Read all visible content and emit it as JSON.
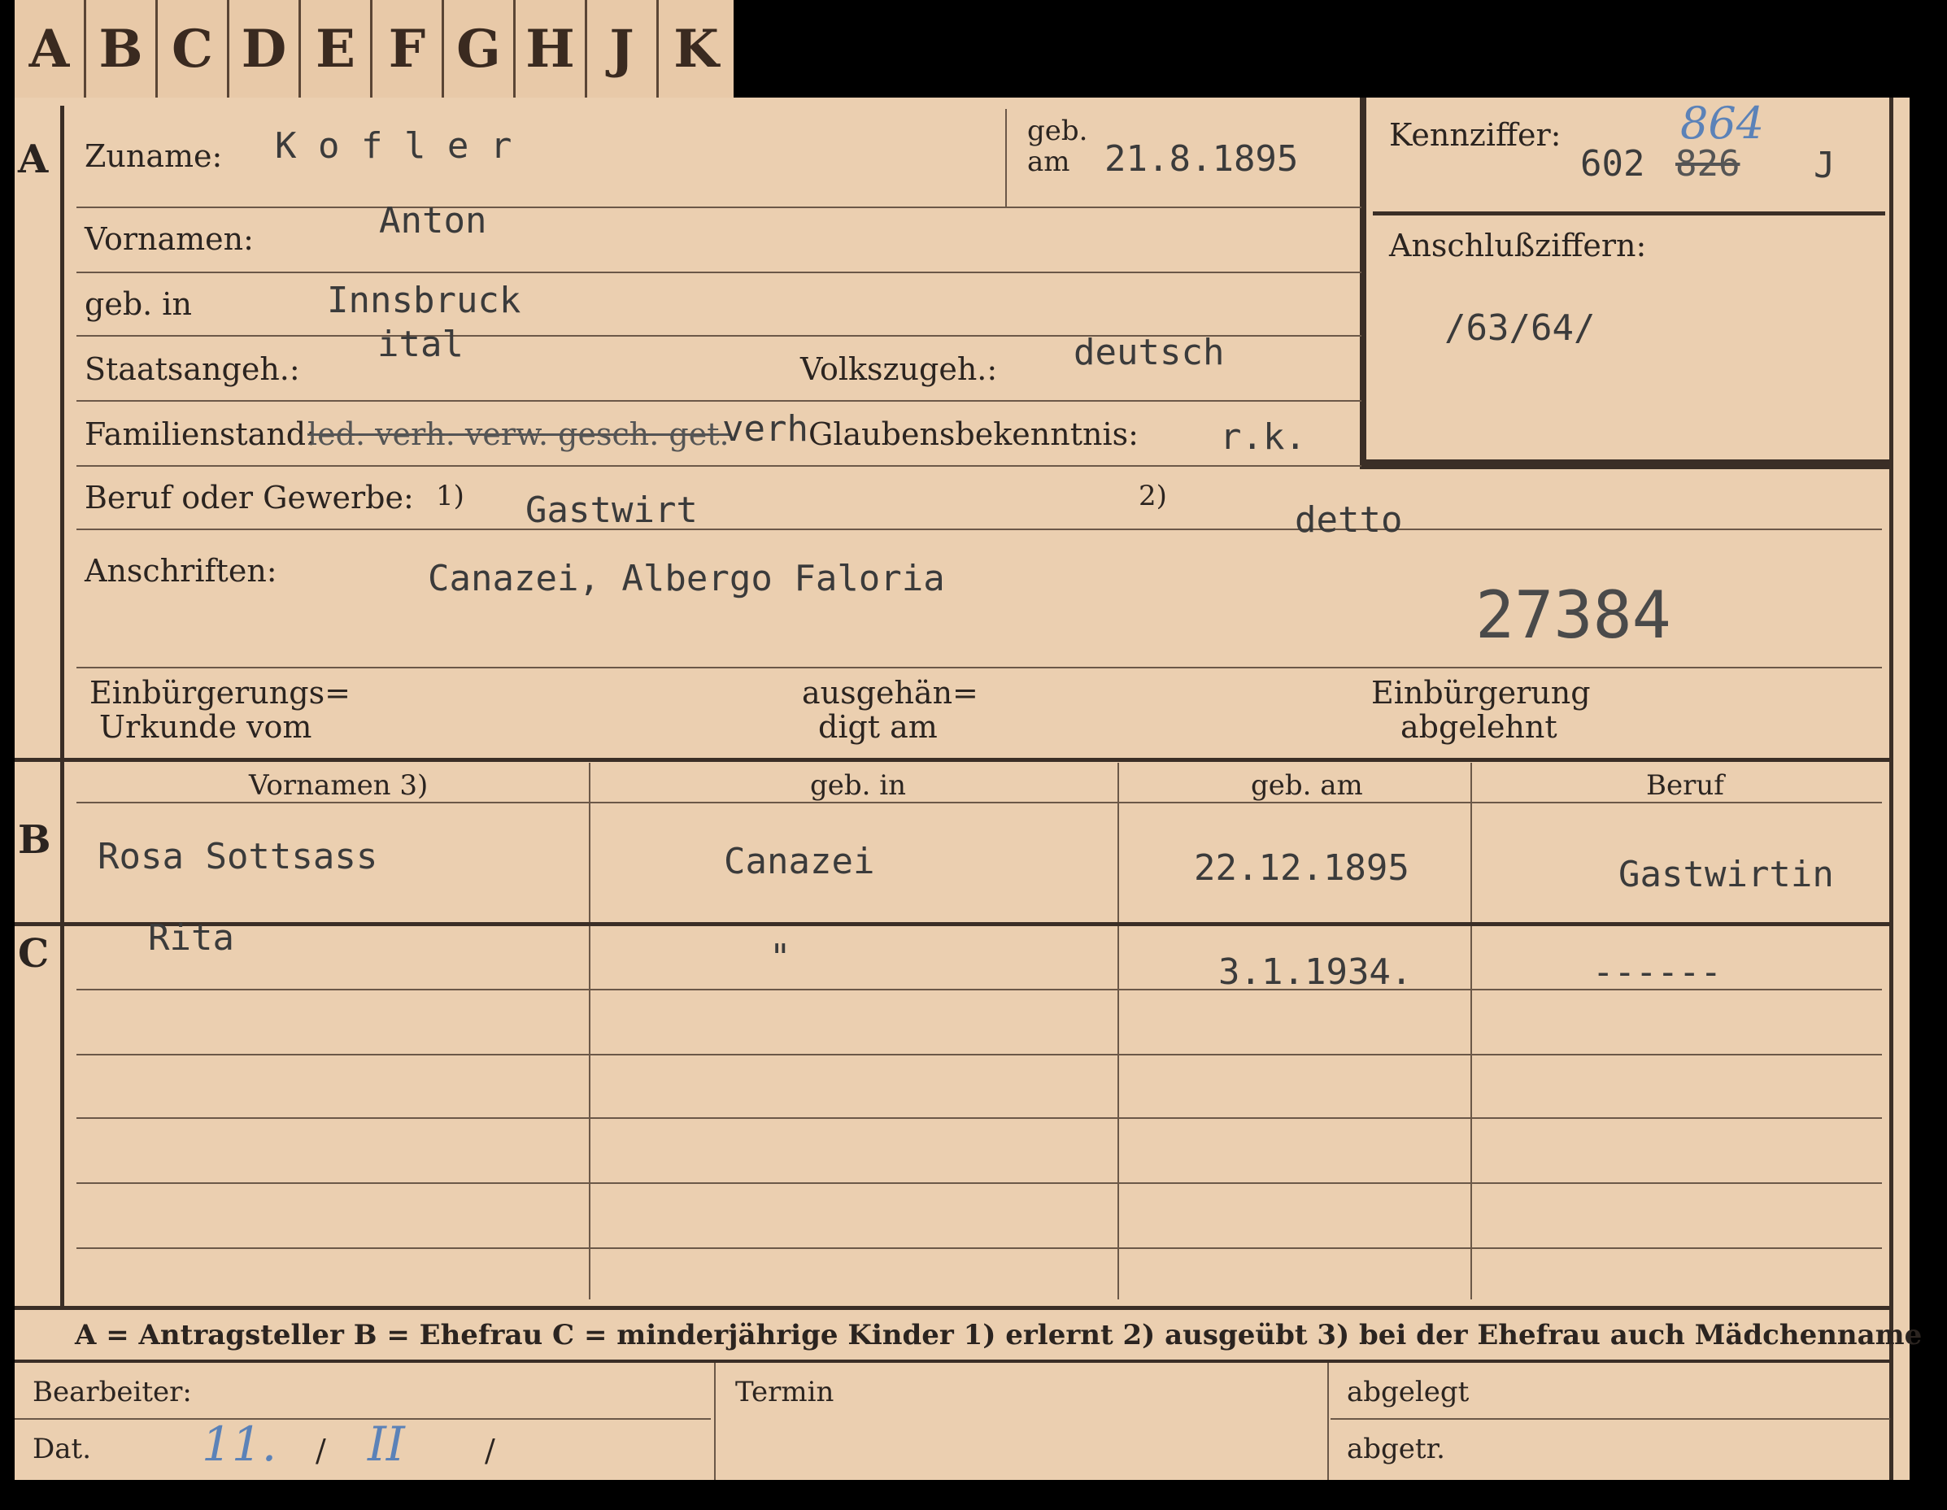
{
  "tabs": [
    "A",
    "B",
    "C",
    "D",
    "E",
    "F",
    "G",
    "H",
    "J",
    "K"
  ],
  "sections": {
    "a": "A",
    "b": "B",
    "c": "C"
  },
  "labels": {
    "zuname": "Zuname:",
    "geb_am": "geb. am",
    "kennziffer": "Kennziffer:",
    "vornamen": "Vornamen:",
    "anschluss": "Anschlußziffern:",
    "geb_in": "geb. in",
    "staatsangeh": "Staatsangeh.:",
    "volkszugeh": "Volkszugeh.:",
    "familienstand": "Familienstand:",
    "familienstand_options": "led. verh. verw. gesch. get.",
    "glaubens": "Glaubensbekenntnis:",
    "beruf": "Beruf oder Gewerbe:",
    "note1": "1)",
    "note2": "2)",
    "anschriften": "Anschriften:",
    "einb_urkunde_1": "Einbürgerungs=",
    "einb_urkunde_2": "Urkunde vom",
    "ausgeh_1": "ausgehän=",
    "ausgeh_2": "digt am",
    "einb_abgelehnt_1": "Einbürgerung",
    "einb_abgelehnt_2": "abgelehnt"
  },
  "values": {
    "zuname": "K o f l e r",
    "geb_am": "21.8.1895",
    "kennziffer_prefix": "602",
    "kennziffer_struck": "826",
    "kennziffer_hand": "864",
    "kennziffer_suffix": "J",
    "vornamen": "Anton",
    "geb_in": "Innsbruck",
    "staatsangeh": "ital",
    "volkszugeh": "deutsch",
    "anschluss": "/63/64/",
    "familienstand": "verh",
    "glaubens": "r.k.",
    "beruf1": "Gastwirt",
    "beruf2": "detto",
    "anschriften": "Canazei, Albergo Faloria",
    "stamp_number": "27384"
  },
  "table": {
    "headers": [
      "Vornamen 3)",
      "geb. in",
      "geb. am",
      "Beruf"
    ],
    "wife": [
      "Rosa Sottsass",
      "Canazei",
      "22.12.1895",
      "Gastwirtin"
    ],
    "child": [
      "Rita",
      "\"",
      "3.1.1934.",
      "------"
    ]
  },
  "legend": "A = Antragsteller   B = Ehefrau   C = minderjährige Kinder   1) erlernt   2) ausgeübt   3) bei der Ehefrau auch Mädchenname",
  "footer": {
    "bearbeiter": "Bearbeiter:",
    "termin": "Termin",
    "abgelegt": "abgelegt",
    "dat": "Dat.",
    "dat_day": "11.",
    "slash1": "/",
    "dat_month": "II",
    "slash2": "/",
    "abgetr": "abgetr."
  }
}
